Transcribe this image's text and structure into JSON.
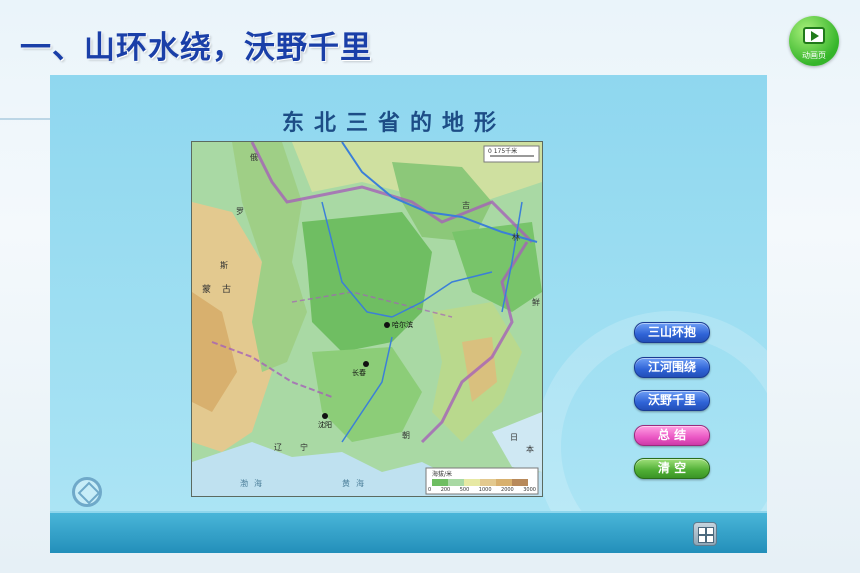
{
  "header": {
    "title": "一、山环水绕，沃野千里"
  },
  "video_button": {
    "icon": "video-play-icon",
    "caption": "动画页"
  },
  "slide": {
    "map_title": "东北三省的地形",
    "map": {
      "scale_label": "0  175千米",
      "cities": [
        {
          "name": "哈尔滨"
        },
        {
          "name": "长春"
        },
        {
          "name": "沈阳"
        }
      ],
      "labels": [
        "俄",
        "罗",
        "斯",
        "蒙",
        "古",
        "吉",
        "林",
        "辽",
        "宁",
        "朝",
        "鲜",
        "日",
        "本",
        "渤",
        "海",
        "黄",
        "海"
      ],
      "legend": {
        "title": "海拔/米",
        "ticks": [
          "0",
          "200",
          "500",
          "1000",
          "2000",
          "3000"
        ]
      }
    },
    "menu": [
      {
        "label": "三山环抱",
        "style": "blue"
      },
      {
        "label": "江河围绕",
        "style": "blue"
      },
      {
        "label": "沃野千里",
        "style": "blue"
      },
      {
        "label": "总  结",
        "style": "pink"
      },
      {
        "label": "清  空",
        "style": "green"
      }
    ]
  },
  "colors": {
    "title_blue": "#1a3fa8",
    "plain_green": "#7cc46b",
    "mountain_tan": "#d9b774",
    "sea_blue": "#bfe1f0",
    "border_purple": "#a562b8"
  }
}
